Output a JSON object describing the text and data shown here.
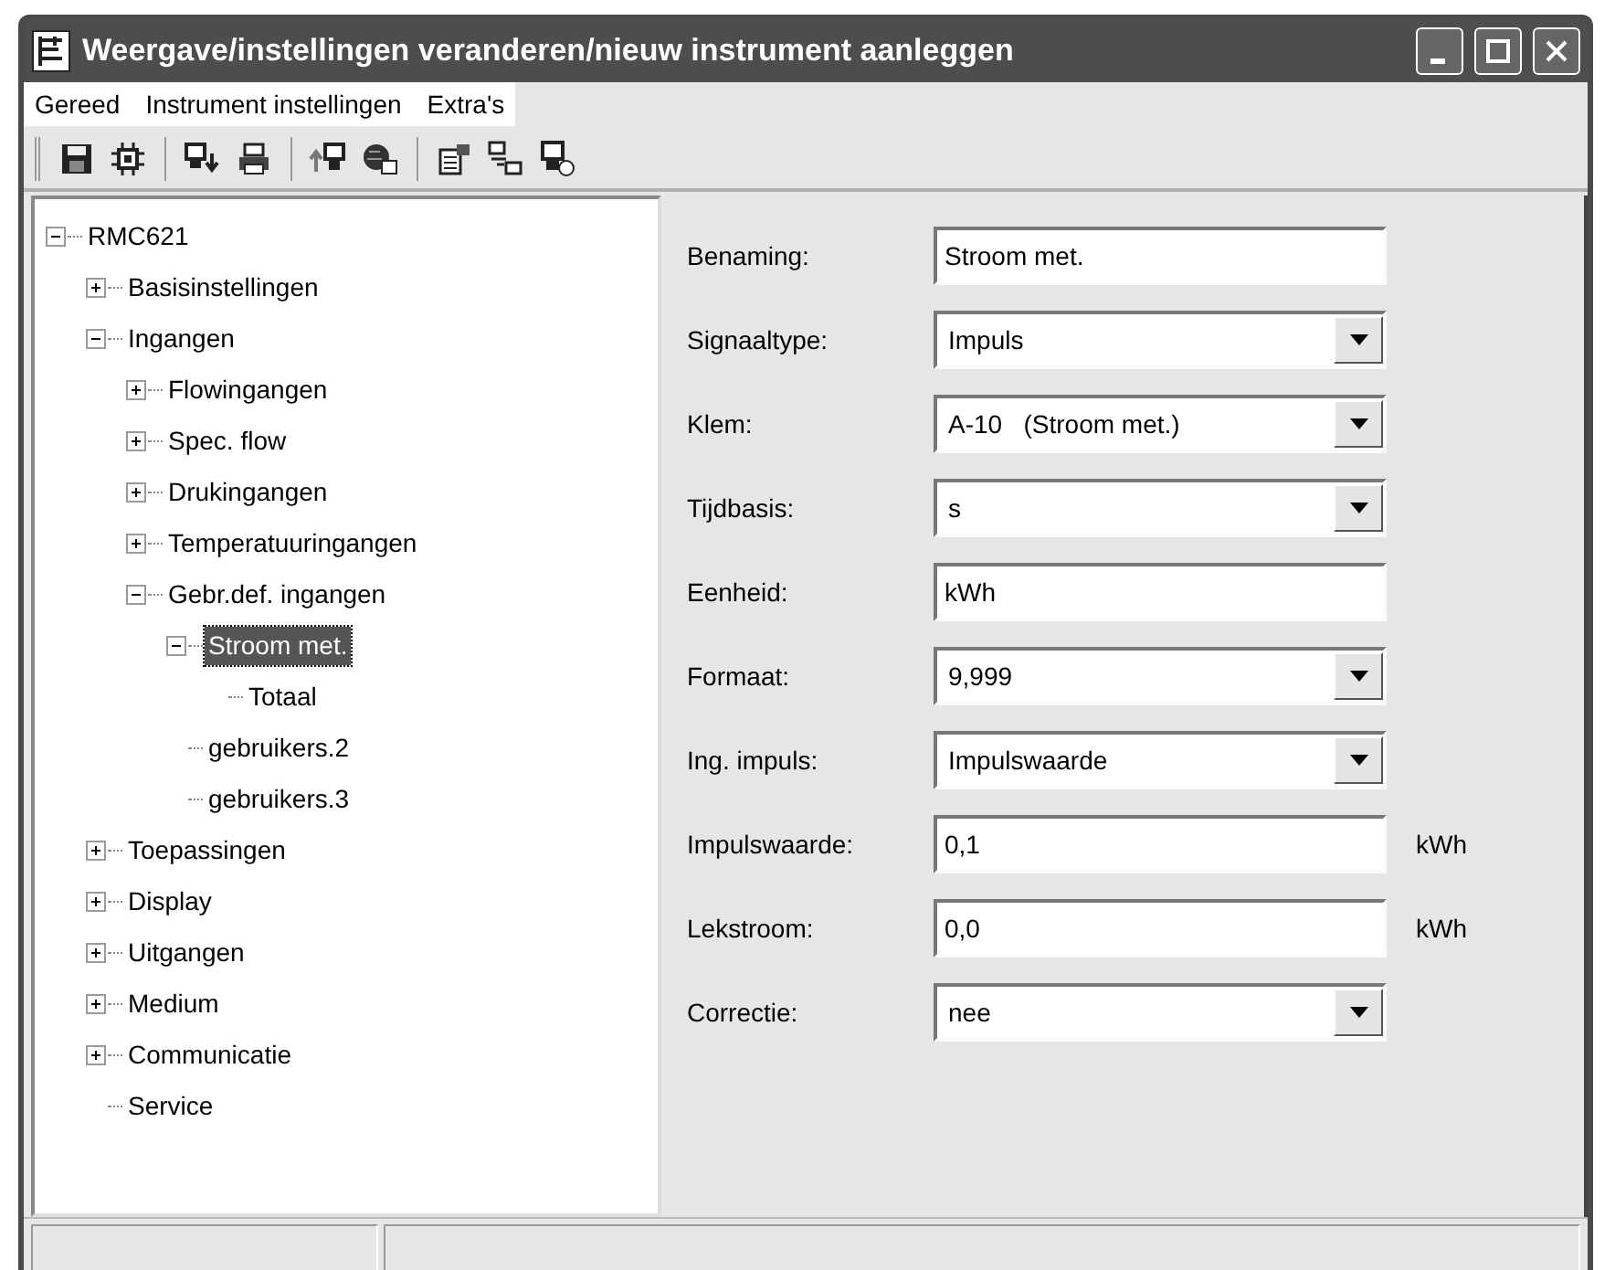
{
  "window": {
    "title": "Weergave/instellingen veranderen/nieuw instrument aanleggen"
  },
  "menu": [
    "Gereed",
    "Instrument instellingen",
    "Extra's"
  ],
  "toolbar": [
    {
      "kind": "floppy",
      "group_start": false
    },
    {
      "kind": "chip",
      "group_start": false
    },
    {
      "kind": "download",
      "group_start": true
    },
    {
      "kind": "printer",
      "group_start": false
    },
    {
      "kind": "upload",
      "group_start": true
    },
    {
      "kind": "globe",
      "group_start": false
    },
    {
      "kind": "properties",
      "group_start": true
    },
    {
      "kind": "network",
      "group_start": false
    },
    {
      "kind": "monitor",
      "group_start": false
    }
  ],
  "tree": [
    {
      "label": "RMC621",
      "expanded": true,
      "selected": false,
      "children": [
        {
          "label": "Basisinstellingen",
          "expanded": false,
          "selected": false
        },
        {
          "label": "Ingangen",
          "expanded": true,
          "selected": false,
          "children": [
            {
              "label": "Flowingangen",
              "expanded": false,
              "selected": false
            },
            {
              "label": "Spec. flow",
              "expanded": false,
              "selected": false
            },
            {
              "label": "Drukingangen",
              "expanded": false,
              "selected": false
            },
            {
              "label": "Temperatuuringangen",
              "expanded": false,
              "selected": false
            },
            {
              "label": "Gebr.def. ingangen",
              "expanded": true,
              "selected": false,
              "children": [
                {
                  "label": "Stroom met.",
                  "expanded": true,
                  "selected": true,
                  "children": [
                    {
                      "label": "Totaal",
                      "selected": false
                    }
                  ]
                },
                {
                  "label": "gebruikers.2",
                  "selected": false
                },
                {
                  "label": "gebruikers.3",
                  "selected": false
                }
              ]
            }
          ]
        },
        {
          "label": "Toepassingen",
          "expanded": false,
          "selected": false
        },
        {
          "label": "Display",
          "expanded": false,
          "selected": false
        },
        {
          "label": "Uitgangen",
          "expanded": false,
          "selected": false
        },
        {
          "label": "Medium",
          "expanded": false,
          "selected": false
        },
        {
          "label": "Communicatie",
          "expanded": false,
          "selected": false
        },
        {
          "label": "Service",
          "selected": false
        }
      ]
    }
  ],
  "form": [
    {
      "kind": "text",
      "label": "Benaming:",
      "value": "Stroom met."
    },
    {
      "kind": "dropdown",
      "label": "Signaaltype:",
      "value": "Impuls"
    },
    {
      "kind": "dropdown",
      "label": "Klem:",
      "value": "A-10   (Stroom met.)"
    },
    {
      "kind": "dropdown",
      "label": "Tijdbasis:",
      "value": "s"
    },
    {
      "kind": "text",
      "label": "Eenheid:",
      "value": "kWh"
    },
    {
      "kind": "dropdown",
      "label": "Formaat:",
      "value": "9,999"
    },
    {
      "kind": "dropdown",
      "label": "Ing. impuls:",
      "value": "Impulswaarde"
    },
    {
      "kind": "text",
      "label": "Impulswaarde:",
      "value": "0,1",
      "unit": "kWh"
    },
    {
      "kind": "text",
      "label": "Lekstroom:",
      "value": "0,0",
      "unit": "kWh"
    },
    {
      "kind": "dropdown",
      "label": "Correctie:",
      "value": "nee"
    }
  ]
}
